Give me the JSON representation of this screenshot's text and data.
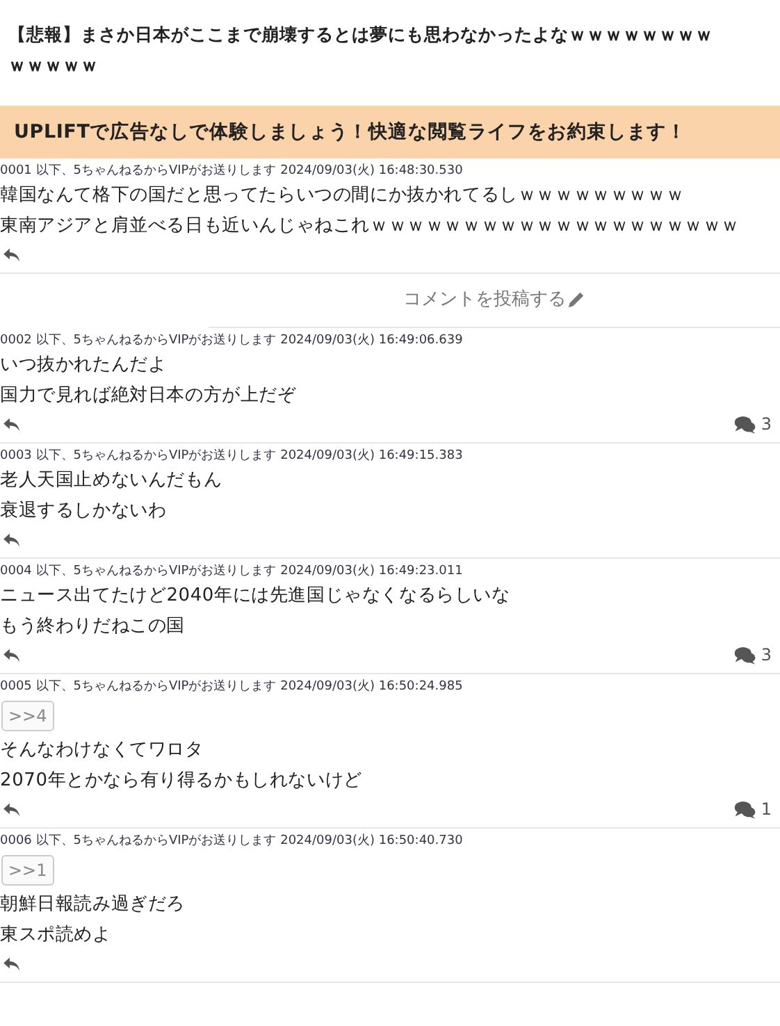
{
  "title_lines": [
    "【悲報】まさか日本がここまで崩壊するとは夢にも思わなかったよなｗｗｗｗｗｗｗｗ",
    "ｗｗｗｗｗ"
  ],
  "banner": "UPLIFTで広告なしで体験しましょう！快適な閲覧ライフをお約束します！",
  "posts": [
    {
      "header": "0001 以下、5ちゃんねるからVIPがお送りします 2024/09/03(火) 16:48:30.530",
      "lines": [
        "韓国なんて格下の国だと思ってたらいつの間にか抜かれてるしｗｗｗｗｗｗｗｗｗ",
        "東南アジアと肩並べる日も近いんじゃねこれｗｗｗｗｗｗｗｗｗｗｗｗｗｗｗｗｗｗｗｗ"
      ]
    },
    {
      "header": "0002 以下、5ちゃんねるからVIPがお送りします 2024/09/03(火) 16:49:06.639",
      "lines": [
        "いつ抜かれたんだよ",
        "国力で見れば絶対日本の方が上だぞ"
      ],
      "reply_count": "3"
    },
    {
      "header": "0003 以下、5ちゃんねるからVIPがお送りします 2024/09/03(火) 16:49:15.383",
      "lines": [
        "老人天国止めないんだもん",
        "衰退するしかないわ"
      ]
    },
    {
      "header": "0004 以下、5ちゃんねるからVIPがお送りします 2024/09/03(火) 16:49:23.011",
      "lines": [
        "ニュース出てたけど2040年には先進国じゃなくなるらしいな",
        "もう終わりだねこの国"
      ],
      "reply_count": "3"
    },
    {
      "header": "0005 以下、5ちゃんねるからVIPがお送りします 2024/09/03(火) 16:50:24.985",
      "anchor": ">>4",
      "lines": [
        "そんなわけなくてワロタ",
        "2070年とかなら有り得るかもしれないけど"
      ],
      "reply_count": "1"
    },
    {
      "header": "0006 以下、5ちゃんねるからVIPがお送りします 2024/09/03(火) 16:50:40.730",
      "anchor": ">>1",
      "lines": [
        "朝鮮日報読み過ぎだろ",
        "東スポ読めよ"
      ]
    }
  ],
  "comment_button": "コメントを投稿する"
}
